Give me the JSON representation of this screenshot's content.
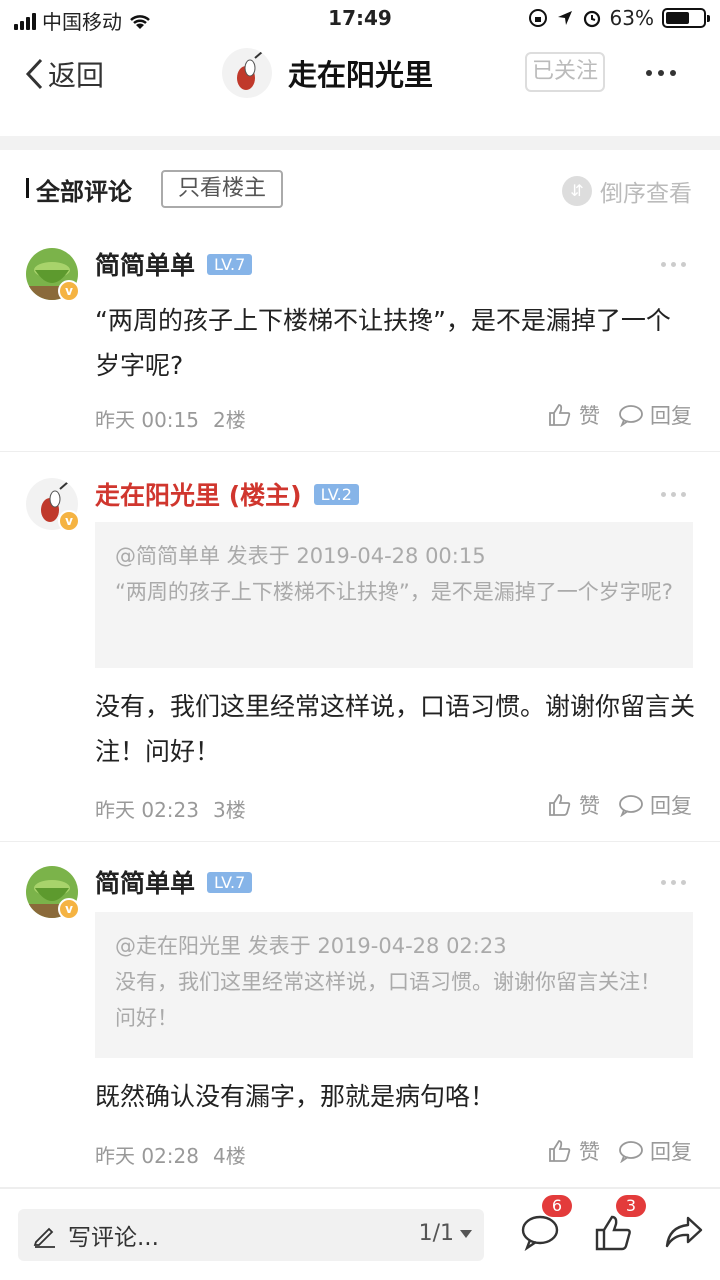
{
  "status_bar": {
    "carrier": "中国移动",
    "time": "17:49",
    "battery_percent": "63%",
    "battery_level": 0.63
  },
  "nav": {
    "back_label": "返回",
    "title": "走在阳光里",
    "follow_label": "已关注"
  },
  "filter": {
    "all_comments": "全部评论",
    "only_op": "只看楼主",
    "sort_label": "倒序查看"
  },
  "comments": [
    {
      "author": "简简单单",
      "level": "LV.7",
      "text": "“两周的孩子上下楼梯不让扶搀”，是不是漏掉了一个岁字呢?",
      "time": "昨天 00:15",
      "floor": "2楼",
      "like_label": "赞",
      "reply_label": "回复"
    },
    {
      "author": "走在阳光里 (楼主)",
      "level": "LV.2",
      "quote_head": "@简简单单 发表于 2019-04-28 00:15",
      "quote_text": "“两周的孩子上下楼梯不让扶搀”，是不是漏掉了一个岁字呢?",
      "text": "没有，我们这里经常这样说，口语习惯。谢谢你留言关注！问好！",
      "time": "昨天 02:23",
      "floor": "3楼",
      "like_label": "赞",
      "reply_label": "回复"
    },
    {
      "author": "简简单单",
      "level": "LV.7",
      "quote_head": "@走在阳光里 发表于 2019-04-28 02:23",
      "quote_text": "没有，我们这里经常这样说，口语习惯。谢谢你留言关注！问好！",
      "text": "既然确认没有漏字，那就是病句咯！",
      "time": "昨天 02:28",
      "floor": "4楼",
      "like_label": "赞",
      "reply_label": "回复"
    }
  ],
  "bottom_bar": {
    "write_placeholder": "写评论...",
    "page_indicator": "1/1",
    "comment_count": "6",
    "like_count": "3"
  }
}
